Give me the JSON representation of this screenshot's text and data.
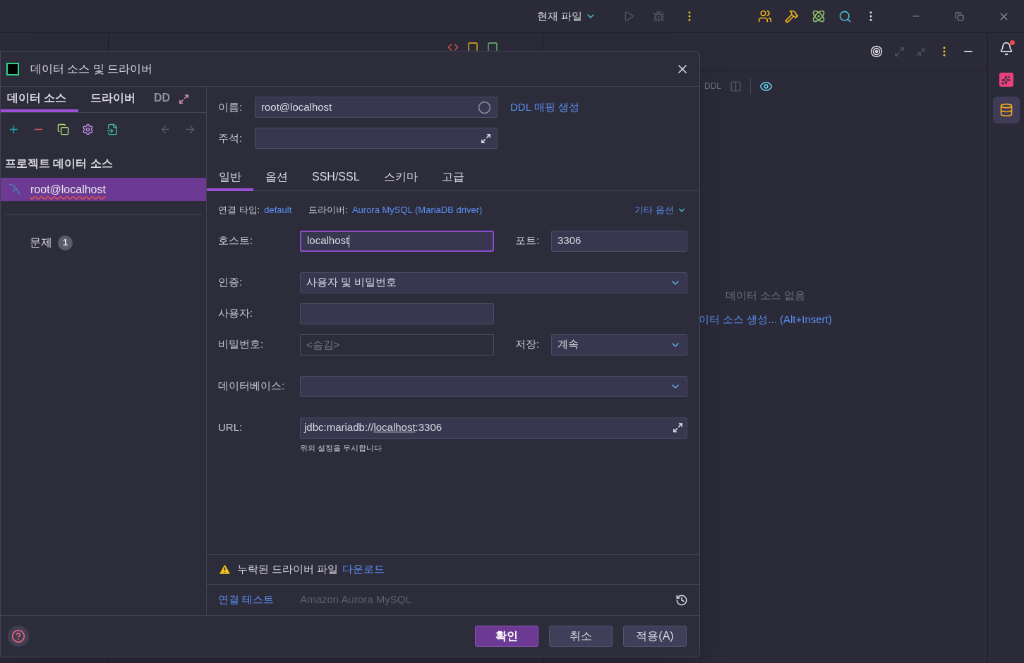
{
  "toolbar": {
    "run_config": "현재 파일"
  },
  "database_panel": {
    "toolbar_label": "DDL",
    "empty_text": "데이터 소스 없음",
    "create_link": "이터 소스 생성... (Alt+Insert)"
  },
  "dialog": {
    "title": "데이터 소스 및 드라이버",
    "left_tabs": [
      {
        "label": "데이터 소스",
        "selected": true
      },
      {
        "label": "드라이버",
        "selected": false
      },
      {
        "label": "DD",
        "selected": false
      }
    ],
    "section_header": "프로젝트 데이터 소스",
    "sources": [
      {
        "name": "root@localhost",
        "selected": true,
        "misspelled": true
      }
    ],
    "problems": {
      "label": "문제",
      "count": "1"
    },
    "name": {
      "label": "이름:",
      "value": "root@localhost"
    },
    "ddl_link": "DDL 매핑 생성",
    "comment": {
      "label": "주석:"
    },
    "tabs": [
      {
        "label": "일반",
        "selected": true
      },
      {
        "label": "옵션",
        "selected": false
      },
      {
        "label": "SSH/SSL",
        "selected": false
      },
      {
        "label": "스키마",
        "selected": false
      },
      {
        "label": "고급",
        "selected": false
      }
    ],
    "connection_type": {
      "label": "연결 타입:",
      "value": "default"
    },
    "driver": {
      "label": "드라이버:",
      "value": "Aurora MySQL (MariaDB driver)"
    },
    "more_options": "기타 옵션",
    "host": {
      "label": "호스트:",
      "value": "localhost",
      "focused": true
    },
    "port": {
      "label": "포트:",
      "value": "3306"
    },
    "auth": {
      "label": "인증:",
      "value": "사용자 및 비밀번호"
    },
    "user": {
      "label": "사용자:"
    },
    "password": {
      "label": "비밀번호:",
      "placeholder": "<숨김>"
    },
    "save": {
      "label": "저장:",
      "value": "계속"
    },
    "database": {
      "label": "데이터베이스:"
    },
    "url": {
      "label": "URL:",
      "parts": [
        {
          "text": "jdbc:mariadb://",
          "underlined": false
        },
        {
          "text": "localhost",
          "underlined": true
        },
        {
          "text": ":3306",
          "underlined": false
        }
      ]
    },
    "url_hint": "위의 설정을 무시합니다",
    "warning": {
      "text": "누락된 드라이버 파일",
      "link": "다운로드"
    },
    "test_link": "연결 테스트",
    "driver_name": "Amazon Aurora MySQL",
    "buttons": [
      {
        "label": "확인",
        "kind": "primary"
      },
      {
        "label": "취소",
        "kind": "secondary"
      },
      {
        "label": "적용(A)",
        "kind": "secondary"
      }
    ]
  }
}
